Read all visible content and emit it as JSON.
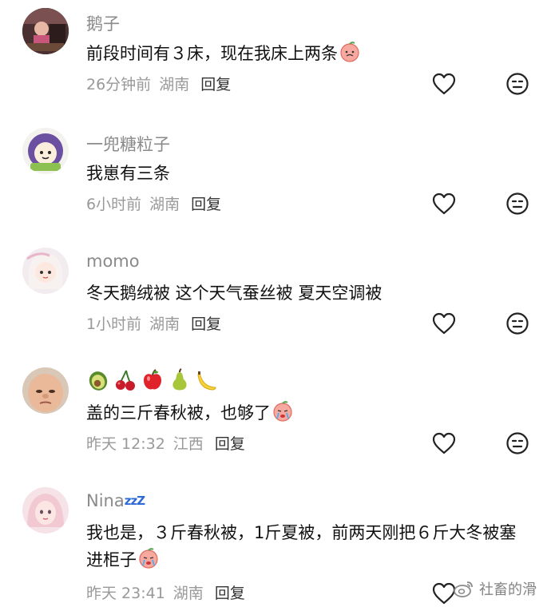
{
  "comments": [
    {
      "username": "鹅子",
      "text": "前段时间有３床，现在我床上两条",
      "time": "26分钟前",
      "location": "湖南",
      "reply_label": "回复"
    },
    {
      "username": "一兜糖粒子",
      "text": "我崽有三条",
      "time": "6小时前",
      "location": "湖南",
      "reply_label": "回复"
    },
    {
      "username": "momo",
      "text": "冬天鹅绒被 这个天气蚕丝被 夏天空调被",
      "time": "1小时前",
      "location": "湖南",
      "reply_label": "回复"
    },
    {
      "username_icons": [
        "avocado-icon",
        "cherry-icon",
        "apple-icon",
        "pear-icon",
        "banana-icon"
      ],
      "text": "盖的三斤春秋被，也够了",
      "time": "昨天 12:32",
      "location": "江西",
      "reply_label": "回复"
    },
    {
      "username": "Nina",
      "username_suffix": "zzZ",
      "text": "我也是，３斤春秋被，1斤夏被，前两天刚把６斤大冬被塞进柜子",
      "time": "昨天 23:41",
      "location": "湖南",
      "reply_label": "回复"
    }
  ],
  "watermark": "社畜的滑",
  "colors": {
    "username": "#8a8a8a",
    "meta": "#999999",
    "text": "#111111",
    "icon_stroke": "#222222"
  }
}
